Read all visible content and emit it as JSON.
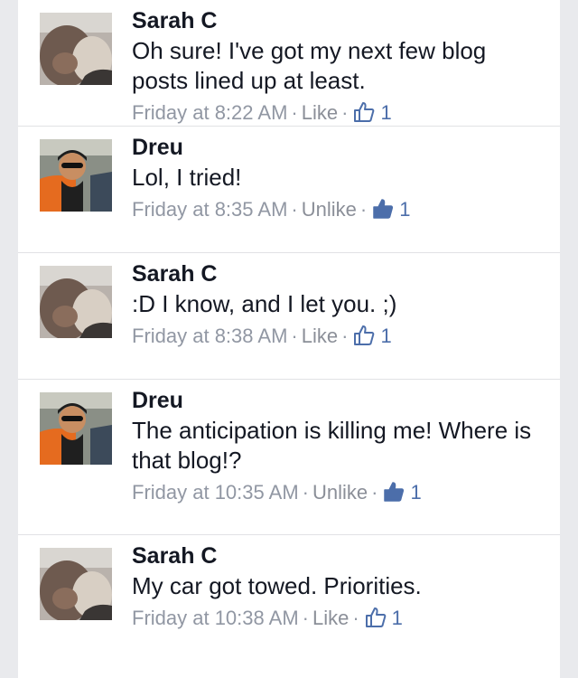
{
  "colors": {
    "background": "#e9eaed",
    "card": "#ffffff",
    "text": "#141823",
    "meta": "#9197a3",
    "like_accent": "#4c6eaa"
  },
  "comments": [
    {
      "author": "Sarah C",
      "text": "Oh sure! I've got my next few blog posts lined up at least.",
      "time": "Friday at 8:22 AM",
      "action": "Like",
      "likes": "1",
      "icon": "thumbs-up-outline-icon",
      "avatar": "sarah"
    },
    {
      "author": "Dreu",
      "text": "Lol, I tried!",
      "time": "Friday at 8:35 AM",
      "action": "Unlike",
      "likes": "1",
      "icon": "thumbs-up-filled-icon",
      "avatar": "dreu"
    },
    {
      "author": "Sarah C",
      "text": ":D I know, and I let you. ;)",
      "time": "Friday at 8:38 AM",
      "action": "Like",
      "likes": "1",
      "icon": "thumbs-up-outline-icon",
      "avatar": "sarah"
    },
    {
      "author": "Dreu",
      "text": "The anticipation is killing me! Where is that blog!?",
      "time": "Friday at 10:35 AM",
      "action": "Unlike",
      "likes": "1",
      "icon": "thumbs-up-filled-icon",
      "avatar": "dreu"
    },
    {
      "author": "Sarah C",
      "text": "My car got towed. Priorities.",
      "time": "Friday at 10:38 AM",
      "action": "Like",
      "likes": "1",
      "icon": "thumbs-up-outline-icon",
      "avatar": "sarah"
    }
  ],
  "separator": "·"
}
